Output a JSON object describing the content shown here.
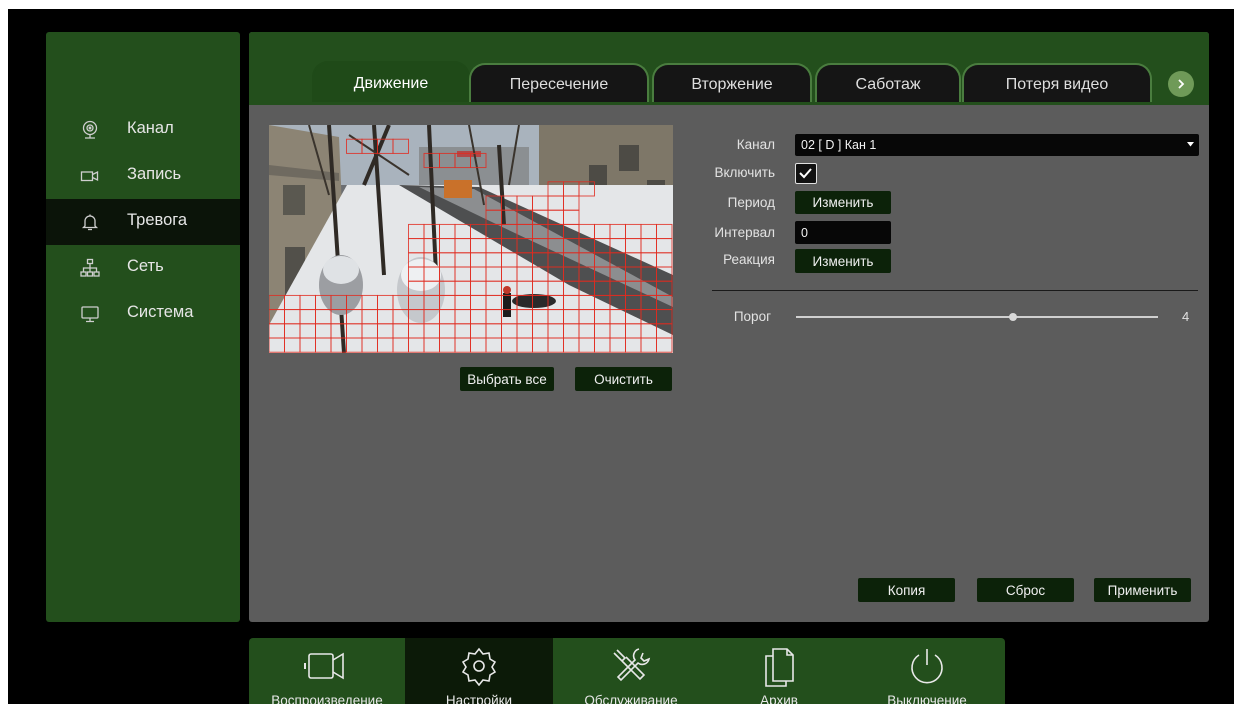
{
  "sidebar": {
    "items": [
      {
        "label": "Канал",
        "icon": "webcam-icon",
        "active": false
      },
      {
        "label": "Запись",
        "icon": "video-camera-icon",
        "active": false
      },
      {
        "label": "Тревога",
        "icon": "bell-icon",
        "active": true
      },
      {
        "label": "Сеть",
        "icon": "network-icon",
        "active": false
      },
      {
        "label": "Система",
        "icon": "monitor-icon",
        "active": false
      }
    ]
  },
  "tabs": [
    {
      "label": "Движение",
      "active": true
    },
    {
      "label": "Пересечение",
      "active": false
    },
    {
      "label": "Вторжение",
      "active": false
    },
    {
      "label": "Саботаж",
      "active": false
    },
    {
      "label": "Потеря видео",
      "active": false
    }
  ],
  "preview": {
    "select_all_label": "Выбрать все",
    "clear_label": "Очистить"
  },
  "form": {
    "channel_label": "Канал",
    "channel_value": "02 [ D ] Кан 1",
    "enable_label": "Включить",
    "enable_checked": true,
    "period_label": "Период",
    "period_button": "Изменить",
    "interval_label": "Интервал",
    "interval_value": "0",
    "reaction_label": "Реакция",
    "reaction_button": "Изменить",
    "threshold_label": "Порог",
    "threshold_value": "4",
    "threshold_level": 0.6
  },
  "footer_buttons": {
    "copy": "Копия",
    "reset": "Сброс",
    "apply": "Применить"
  },
  "dock": [
    {
      "label": "Воспроизведение",
      "icon": "video-camera-icon",
      "active": false
    },
    {
      "label": "Настройки",
      "icon": "gear-icon",
      "active": true
    },
    {
      "label": "Обслуживание",
      "icon": "tools-icon",
      "active": false
    },
    {
      "label": "Архив",
      "icon": "files-icon",
      "active": false
    },
    {
      "label": "Выключение",
      "icon": "power-icon",
      "active": false
    }
  ],
  "colors": {
    "panel_green": "#234f1c",
    "active_dark": "#0c1a08",
    "accent_red": "#e02b20",
    "content_gray": "#5c5c5c"
  }
}
